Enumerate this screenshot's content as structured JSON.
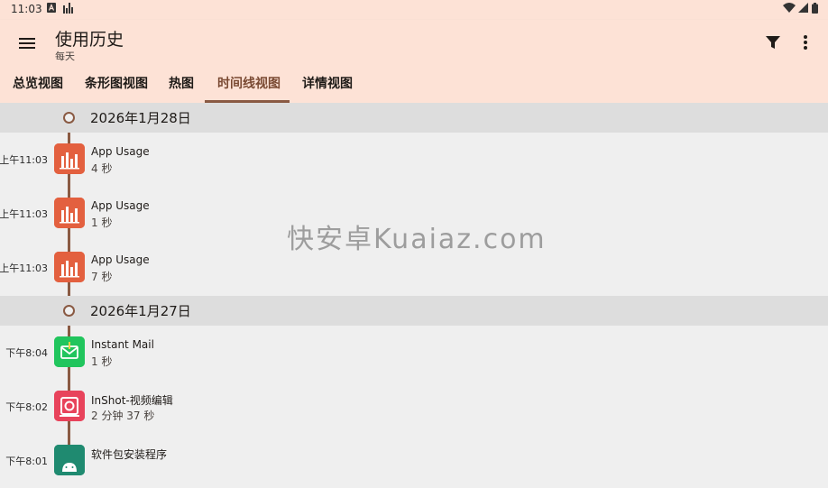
{
  "status_bar": {
    "time": "11:03",
    "left_icons": [
      "notification-a-icon",
      "bar-chart-icon"
    ],
    "right_icons": [
      "wifi-icon",
      "signal-icon",
      "battery-icon"
    ]
  },
  "app_bar": {
    "title": "使用历史",
    "subtitle": "每天",
    "actions": [
      "menu-icon",
      "filter-icon",
      "more-vert-icon"
    ]
  },
  "tabs": [
    {
      "label": "总览视图",
      "active": false
    },
    {
      "label": "条形图视图",
      "active": false
    },
    {
      "label": "热图",
      "active": false
    },
    {
      "label": "时间线视图",
      "active": true
    },
    {
      "label": "详情视图",
      "active": false
    }
  ],
  "colors": {
    "header_bg": "#fde2d6",
    "accent": "#8a5a43",
    "app_usage_icon": "#e3603f",
    "instant_mail_icon": "#21c55d",
    "inshot_icon": "#e8435b",
    "installer_icon": "#1f8a70"
  },
  "groups": [
    {
      "date": "2026年1月28日",
      "entries": [
        {
          "time": "上午11:03",
          "app": "App Usage",
          "duration": "4 秒",
          "icon": "app-usage-icon"
        },
        {
          "time": "上午11:03",
          "app": "App Usage",
          "duration": "1 秒",
          "icon": "app-usage-icon"
        },
        {
          "time": "上午11:03",
          "app": "App Usage",
          "duration": "7 秒",
          "icon": "app-usage-icon"
        }
      ]
    },
    {
      "date": "2026年1月27日",
      "entries": [
        {
          "time": "下午8:04",
          "app": "Instant Mail",
          "duration": "1 秒",
          "icon": "mail-icon"
        },
        {
          "time": "下午8:02",
          "app": "InShot-视频编辑",
          "duration": "2 分钟 37 秒",
          "icon": "inshot-icon"
        },
        {
          "time": "下午8:01",
          "app": "软件包安装程序",
          "duration": "",
          "icon": "android-icon"
        }
      ]
    }
  ],
  "watermark": "快安卓Kuaiaz.com"
}
